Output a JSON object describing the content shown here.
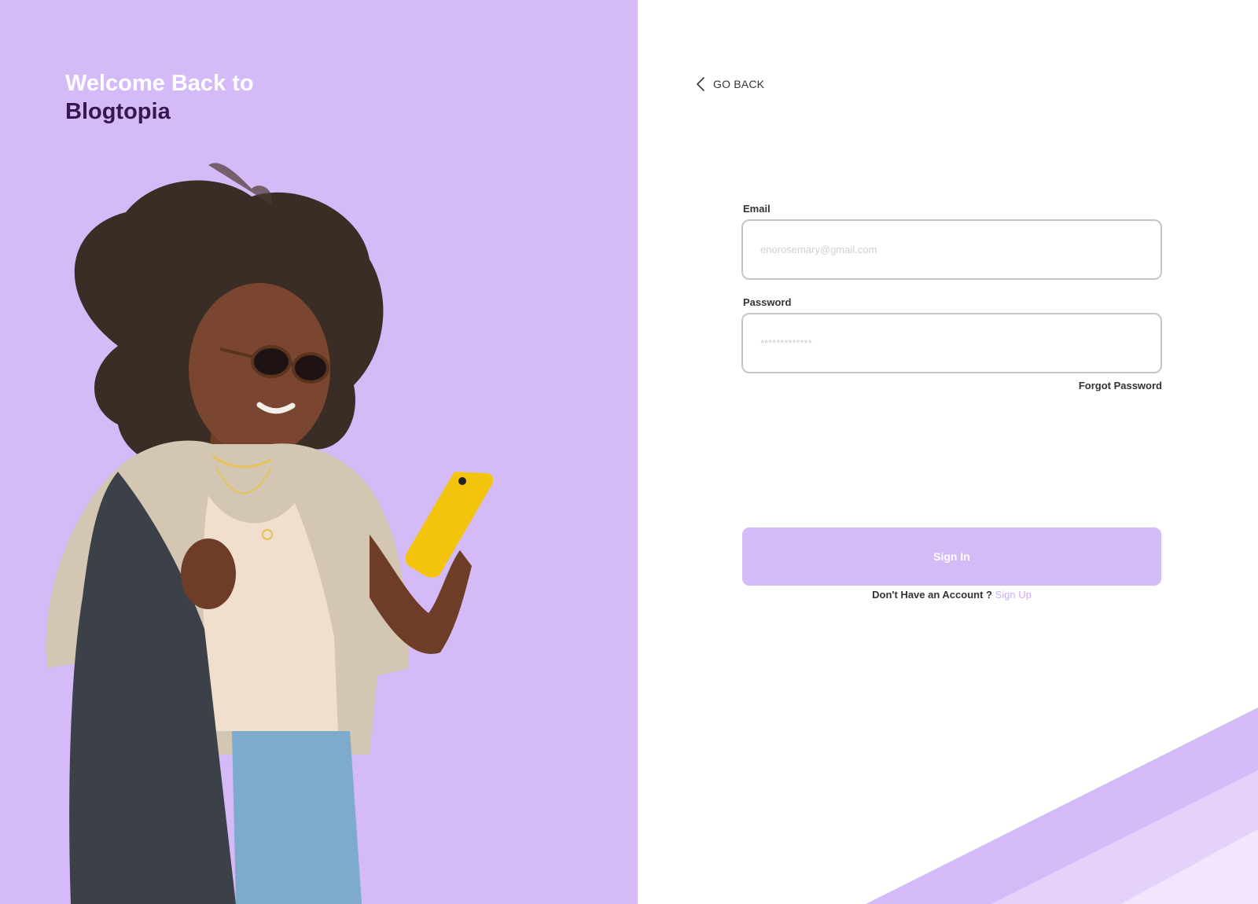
{
  "hero": {
    "title_line1": "Welcome Back to",
    "title_line2": "Blogtopia"
  },
  "nav": {
    "back_label": "GO BACK"
  },
  "form": {
    "email_label": "Email",
    "email_placeholder": "enorosemary@gmail.com",
    "password_label": "Password",
    "password_placeholder": "*************",
    "forgot_label": "Forgot Password",
    "submit_label": "Sign In",
    "no_account_text": "Don't Have an Account ?",
    "signup_label": "Sign Up"
  },
  "colors": {
    "accent": "#d5baf8",
    "accent_dark": "#33194f",
    "link": "#cfa9f6"
  }
}
